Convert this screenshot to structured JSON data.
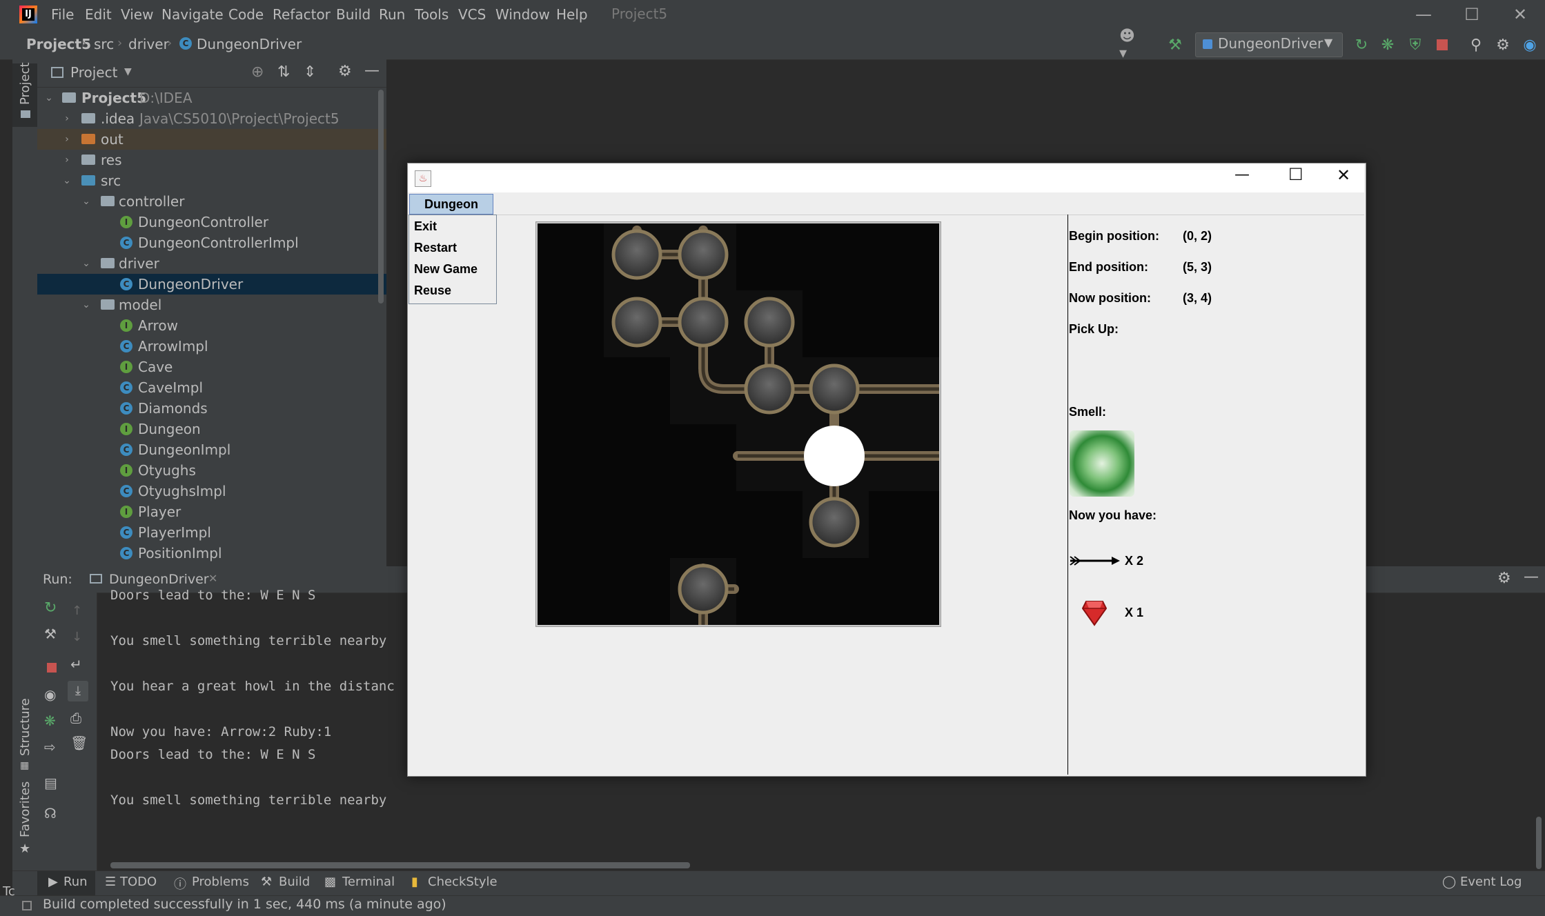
{
  "menubar": {
    "items": [
      "File",
      "Edit",
      "View",
      "Navigate",
      "Code",
      "Refactor",
      "Build",
      "Run",
      "Tools",
      "VCS",
      "Window",
      "Help"
    ],
    "window_title": "Project5",
    "logo_text": "IJ"
  },
  "breadcrumb": [
    "Project5",
    "src",
    "driver",
    "DungeonDriver"
  ],
  "toolbar": {
    "run_config": "DungeonDriver"
  },
  "stripe": {
    "project": "Project",
    "structure": "Structure",
    "favorites": "Favorites"
  },
  "project_panel": {
    "title": "Project",
    "root_label": "Project5",
    "root_path": "D:\\IDEA Java\\CS5010\\Project\\Project5",
    "tree": [
      {
        "label": ".idea",
        "kind": "folder"
      },
      {
        "label": "out",
        "kind": "folder"
      },
      {
        "label": "res",
        "kind": "folder"
      },
      {
        "label": "src",
        "kind": "folder"
      },
      {
        "label": "controller",
        "kind": "package"
      },
      {
        "label": "DungeonController",
        "kind": "interface"
      },
      {
        "label": "DungeonControllerImpl",
        "kind": "class"
      },
      {
        "label": "driver",
        "kind": "package"
      },
      {
        "label": "DungeonDriver",
        "kind": "class"
      },
      {
        "label": "model",
        "kind": "package"
      },
      {
        "label": "Arrow",
        "kind": "interface"
      },
      {
        "label": "ArrowImpl",
        "kind": "class"
      },
      {
        "label": "Cave",
        "kind": "interface"
      },
      {
        "label": "CaveImpl",
        "kind": "class"
      },
      {
        "label": "Diamonds",
        "kind": "class"
      },
      {
        "label": "Dungeon",
        "kind": "interface"
      },
      {
        "label": "DungeonImpl",
        "kind": "class"
      },
      {
        "label": "Otyughs",
        "kind": "interface"
      },
      {
        "label": "OtyughsImpl",
        "kind": "class"
      },
      {
        "label": "Player",
        "kind": "interface"
      },
      {
        "label": "PlayerImpl",
        "kind": "class"
      },
      {
        "label": "PositionImpl",
        "kind": "class"
      }
    ]
  },
  "run_panel": {
    "label": "Run:",
    "tab": "DungeonDriver",
    "console": [
      "Doors lead to the: W E N S",
      "",
      "You smell something terrible nearby",
      "",
      "You hear a great howl in the distanc",
      "",
      "Now you have: Arrow:2 Ruby:1",
      "Doors lead to the: W E N S",
      "",
      "You smell something terrible nearby"
    ]
  },
  "bottom_tabs": [
    "Run",
    "TODO",
    "Problems",
    "Build",
    "Terminal",
    "CheckStyle"
  ],
  "event_log": "Event Log",
  "status": "Build completed successfully in 1 sec, 440 ms (a minute ago)",
  "edge_text": "Tc",
  "swing": {
    "menu": "Dungeon",
    "dropdown": [
      "Exit",
      "Restart",
      "New Game",
      "Reuse"
    ],
    "info": {
      "begin_label": "Begin position:",
      "begin_value": "(0, 2)",
      "end_label": "End position:",
      "end_value": "(5, 3)",
      "now_label": "Now position:",
      "now_value": "(3, 4)",
      "pickup_label": "Pick Up:",
      "smell_label": "Smell:",
      "have_label": "Now you have:",
      "arrow_count": "X 2",
      "ruby_count": "X 1"
    }
  },
  "colors": {
    "ide_bg": "#2b2b2b",
    "ide_panel": "#3c3f41",
    "selection": "#0d293e",
    "swing_bg": "#eeeeee",
    "menu_highlight": "#b8cfe5",
    "ruby": "#d62a2a",
    "smell_green": "#3a9a3a"
  }
}
